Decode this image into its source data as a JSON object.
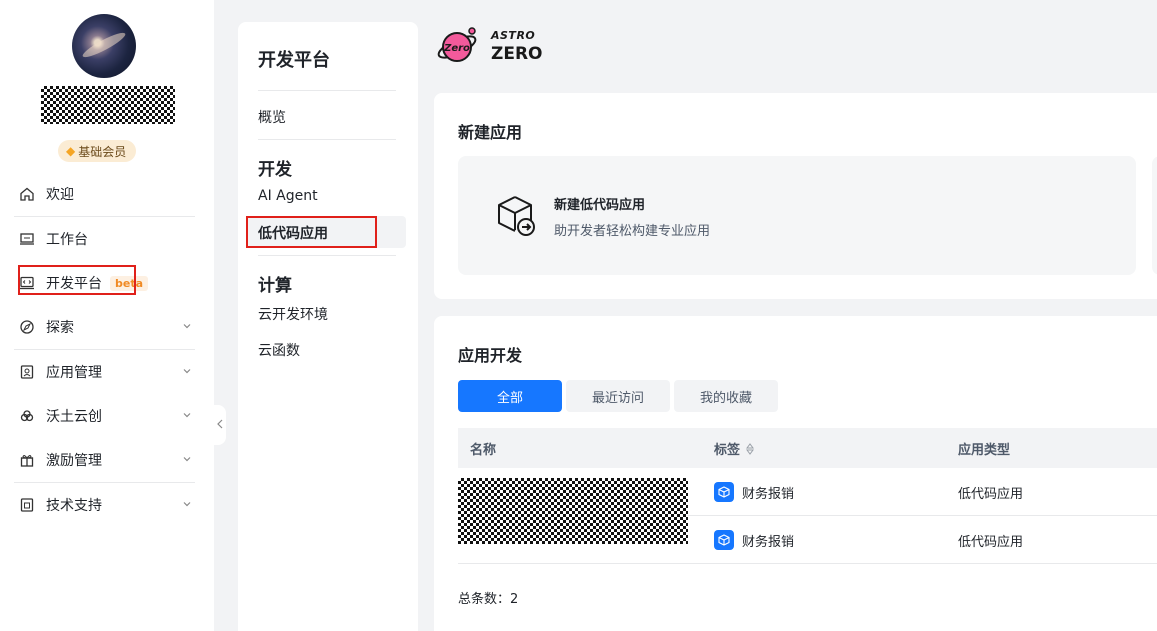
{
  "sidebar": {
    "member_badge": "基础会员",
    "items": [
      {
        "label": "欢迎",
        "icon": "home-icon",
        "expandable": false
      },
      {
        "label": "工作台",
        "icon": "monitor-icon",
        "expandable": false
      },
      {
        "label": "开发平台",
        "icon": "code-window-icon",
        "expandable": false,
        "badge": "beta"
      },
      {
        "label": "探索",
        "icon": "compass-icon",
        "expandable": true
      },
      {
        "label": "应用管理",
        "icon": "app-box-icon",
        "expandable": true
      },
      {
        "label": "沃土云创",
        "icon": "cloud-icon",
        "expandable": true
      },
      {
        "label": "激励管理",
        "icon": "gift-icon",
        "expandable": true
      },
      {
        "label": "技术支持",
        "icon": "support-icon",
        "expandable": true
      }
    ]
  },
  "dev_nav": {
    "title": "开发平台",
    "overview": "概览",
    "group_dev": "开发",
    "ai_agent": "AI Agent",
    "low_code": "低代码应用",
    "group_compute": "计算",
    "cloud_env": "云开发环境",
    "cloud_func": "云函数"
  },
  "logo": {
    "planet_text": "Zero",
    "line1": "ASTRO",
    "line2": "ZERO"
  },
  "new_app": {
    "title": "新建应用",
    "tile_name": "新建低代码应用",
    "tile_desc": "助开发者轻松构建专业应用"
  },
  "app_dev": {
    "title": "应用开发",
    "tabs": [
      "全部",
      "最近访问",
      "我的收藏"
    ],
    "active_tab": 0,
    "columns": [
      "名称",
      "标签",
      "应用类型"
    ],
    "rows": [
      {
        "tag": "财务报销",
        "type": "低代码应用"
      },
      {
        "tag": "财务报销",
        "type": "低代码应用"
      }
    ],
    "total_label": "总条数：",
    "total": "2"
  },
  "colors": {
    "primary": "#1677ff",
    "highlight": "#e0201a",
    "beta": "#f08a24"
  }
}
